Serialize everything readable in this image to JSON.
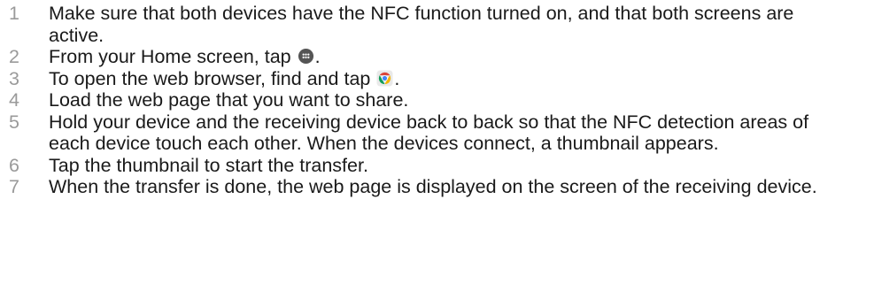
{
  "colors": {
    "step_number": "#9a9a9a",
    "body_text": "#1a1a1a",
    "apps_icon": "#555555",
    "chrome_red": "#db4437",
    "chrome_yellow": "#f4b400",
    "chrome_green": "#0f9d58",
    "chrome_blue": "#4285f4"
  },
  "steps": [
    {
      "number": "1",
      "text": "Make sure that both devices have the NFC function turned on, and that both screens are active."
    },
    {
      "number": "2",
      "text_before": "From your Home screen, tap",
      "icon": "apps-grid-icon",
      "text_after": "."
    },
    {
      "number": "3",
      "text_before": "To open the web browser, find and tap",
      "icon": "chrome-browser-icon",
      "text_after": "."
    },
    {
      "number": "4",
      "text": "Load the web page that you want to share."
    },
    {
      "number": "5",
      "text": "Hold your device and the receiving device back to back so that the NFC detection areas of each device touch each other. When the devices connect, a thumbnail appears."
    },
    {
      "number": "6",
      "text": "Tap the thumbnail to start the transfer."
    },
    {
      "number": "7",
      "text": "When the transfer is done, the web page is displayed on the screen of the receiving device."
    }
  ]
}
